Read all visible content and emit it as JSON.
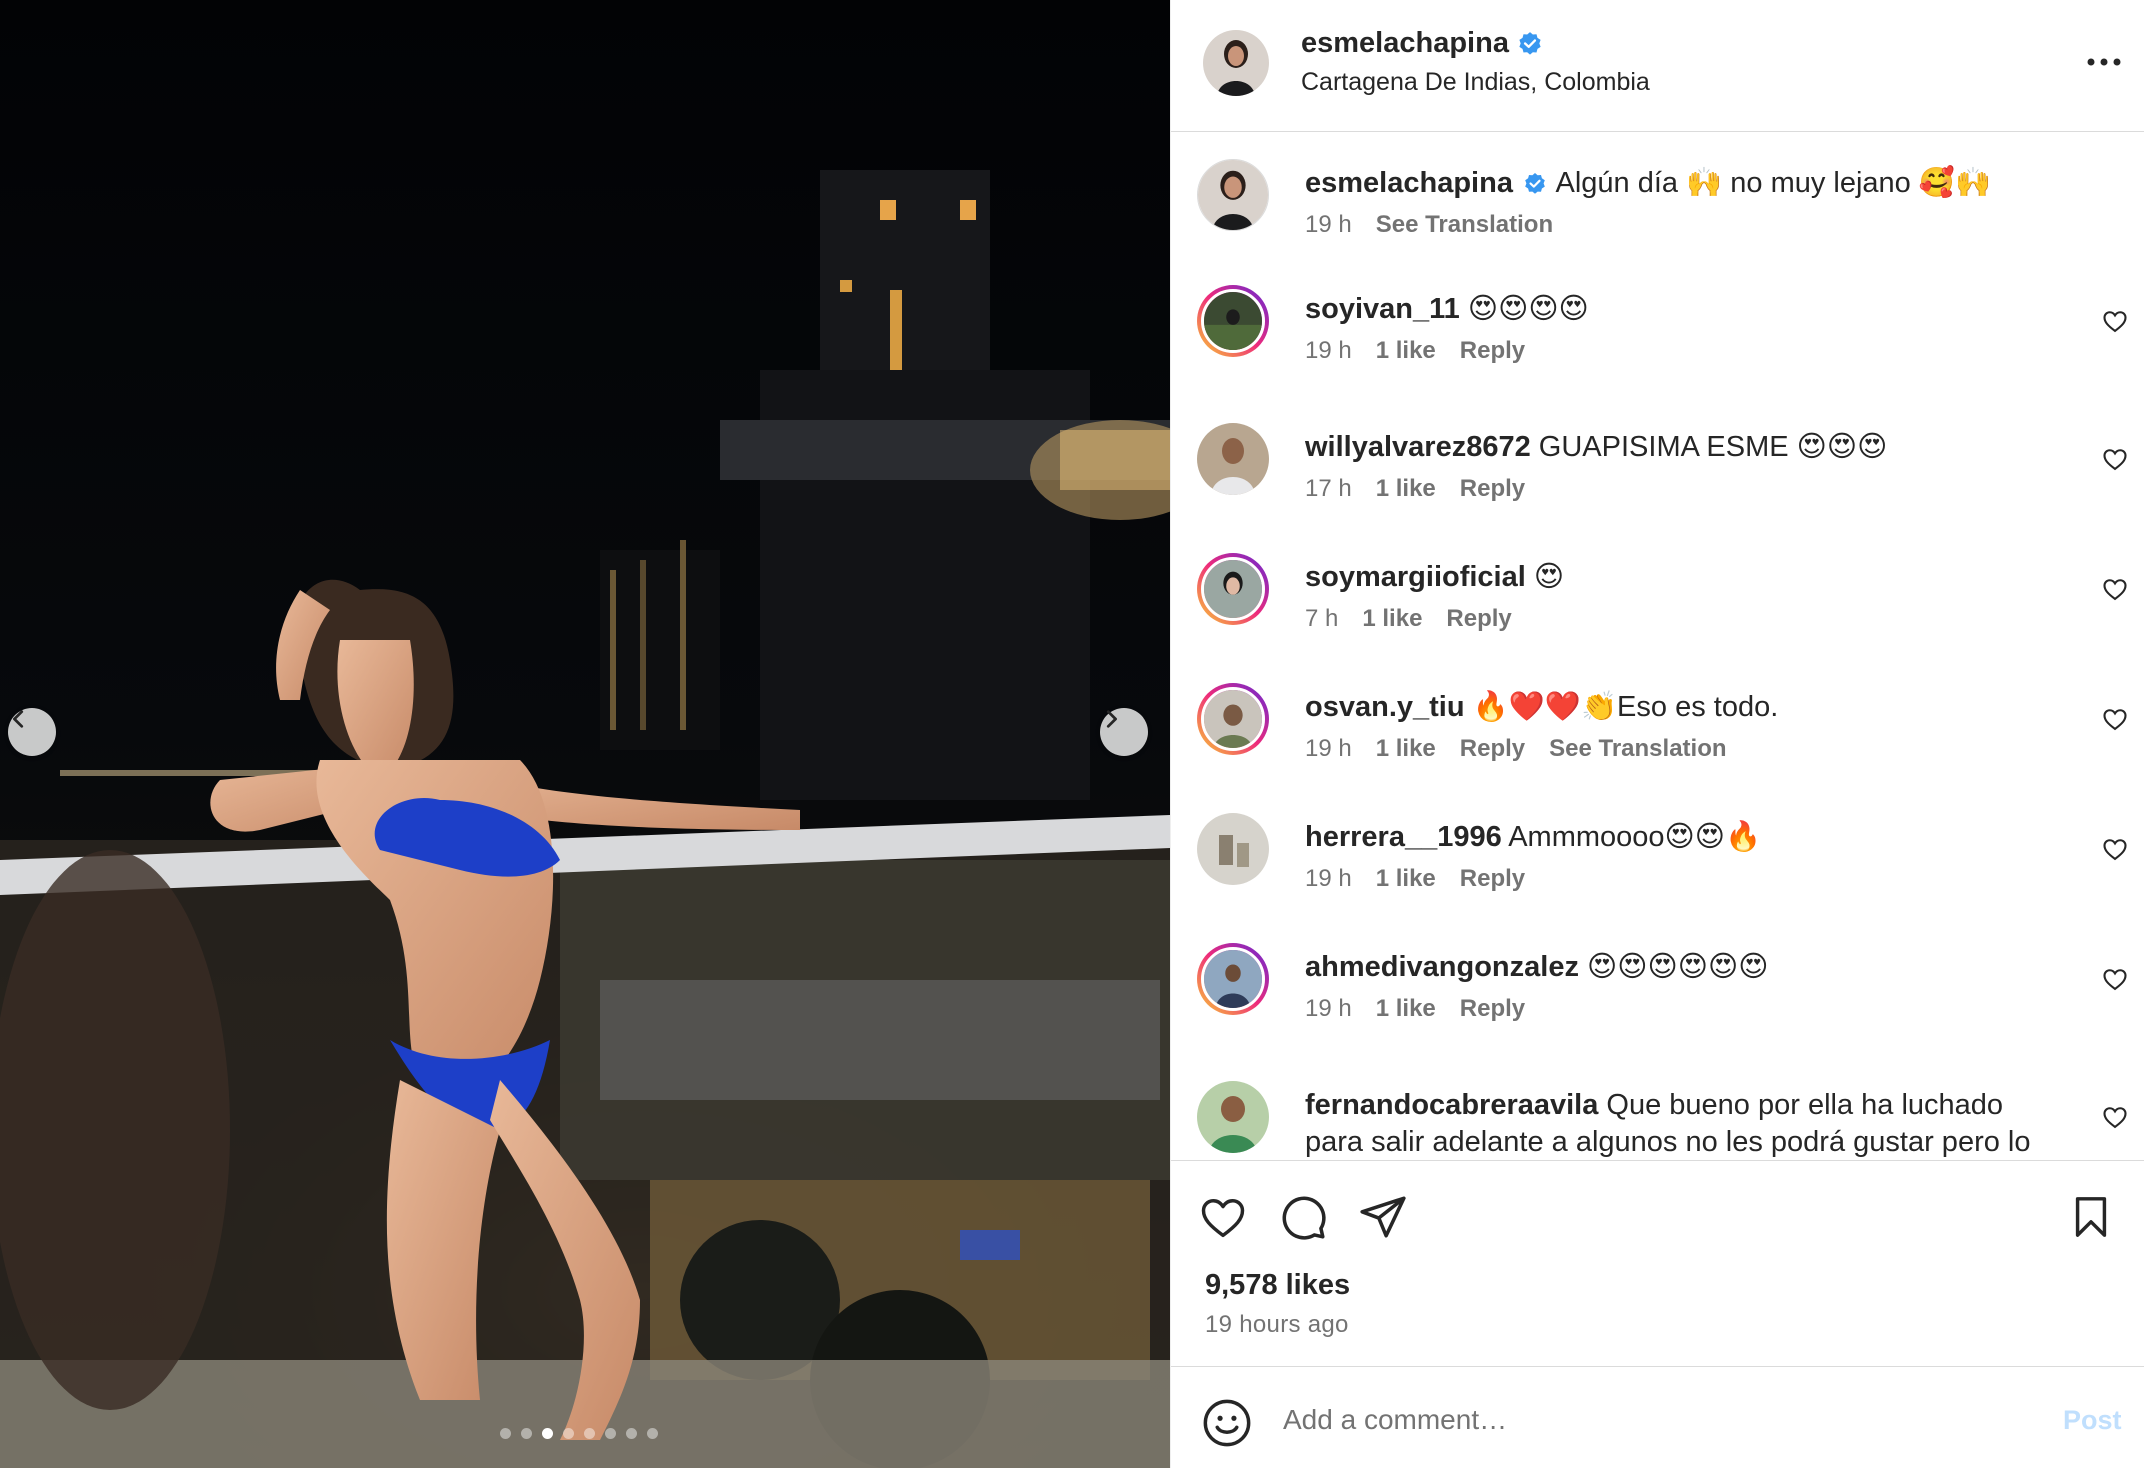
{
  "post": {
    "media": {
      "slide_count": 8,
      "active_slide": 3,
      "prev_icon": "chevron-left-icon",
      "next_icon": "chevron-right-icon"
    },
    "header": {
      "username": "esmelachapina",
      "verified": true,
      "location": "Cartagena De Indias, Colombia",
      "more_icon": "more-horizontal-icon"
    },
    "caption": {
      "username": "esmelachapina",
      "text": "Algún día 🙌 no muy lejano 🥰🙌",
      "time": "19 h",
      "see_translation": "See Translation"
    },
    "comments": [
      {
        "username": "soyivan_11",
        "text": "😍😍😍😍",
        "time": "19 h",
        "likes": "1 like",
        "reply": "Reply"
      },
      {
        "username": "willyalvarez8672",
        "text": "GUAPISIMA ESME 😍😍😍",
        "time": "17 h",
        "likes": "1 like",
        "reply": "Reply"
      },
      {
        "username": "soymargiioficial",
        "text": "😍",
        "time": "7 h",
        "likes": "1 like",
        "reply": "Reply"
      },
      {
        "username": "osvan.y_tiu",
        "text": "🔥❤️❤️👏Eso es todo.",
        "time": "19 h",
        "likes": "1 like",
        "reply": "Reply",
        "see_translation": "See Translation"
      },
      {
        "username": "herrera__1996",
        "text": "Ammmoooo😍😍🔥",
        "time": "19 h",
        "likes": "1 like",
        "reply": "Reply"
      },
      {
        "username": "ahmedivangonzalez",
        "text": "😍😍😍😍😍😍",
        "time": "19 h",
        "likes": "1 like",
        "reply": "Reply"
      },
      {
        "username": "fernandocabreraavila",
        "text": "Que bueno por ella ha luchado para salir adelante a algunos no les podrá gustar pero lo"
      }
    ],
    "actions": {
      "like_icon": "heart-icon",
      "comment_icon": "comment-icon",
      "share_icon": "paper-plane-icon",
      "save_icon": "bookmark-icon",
      "likes": "9,578 likes",
      "time_ago": "19 hours ago"
    },
    "add_comment": {
      "emoji_icon": "smiley-icon",
      "placeholder": "Add a comment…",
      "post_label": "Post"
    },
    "colors": {
      "verified": "#3897f0",
      "text_secondary": "#737373",
      "divider": "#dbdbdb",
      "post_disabled": "#c0dffd"
    }
  }
}
